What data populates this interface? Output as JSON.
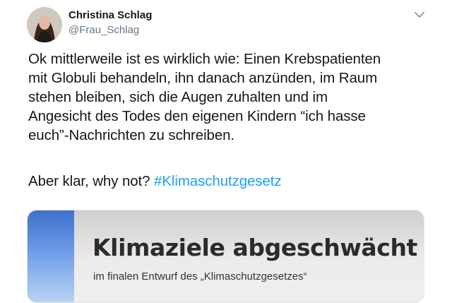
{
  "tweet": {
    "author_name": "Christina Schlag",
    "author_handle": "@Frau_Schlag",
    "text_lines": [
      "Ok mittlerweile ist es wirklich wie: Einen Krebspatienten",
      "mit Globuli behandeln, ihn danach anzünden, im Raum",
      "stehen bleiben, sich die Augen zuhalten und im",
      "Angesicht des Todes den eigenen Kindern “ich hasse",
      "euch”-Nachrichten zu schreiben."
    ],
    "closing_text": "Aber klar, why not? ",
    "hashtag": "#Klimaschutzgesetz",
    "hashtag_color": "#1da1f2",
    "menu_icon": "chevron-down-icon",
    "avatar_icon": "avatar"
  },
  "card": {
    "title": "Klimaziele abgeschwächt",
    "subtitle": "im finalen Entwurf des „Klimaschutzgesetzes“"
  }
}
